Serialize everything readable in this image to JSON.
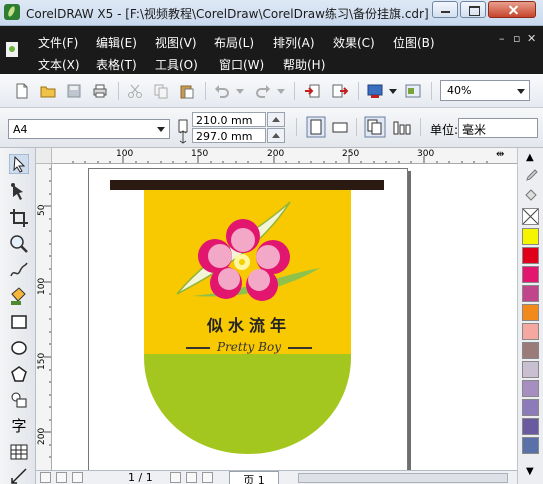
{
  "window": {
    "title": "CorelDRAW X5 - [F:\\视频教程\\CorelDraw\\CorelDraw练习\\备份挂旗.cdr]"
  },
  "menubar": {
    "row1": [
      "文件(F)",
      "编辑(E)",
      "视图(V)",
      "布局(L)",
      "排列(A)",
      "效果(C)",
      "位图(B)"
    ],
    "row2": [
      "文本(X)",
      "表格(T)",
      "工具(O)",
      "窗口(W)",
      "帮助(H)"
    ]
  },
  "toolbar": {
    "zoom": "40%"
  },
  "propbar": {
    "paper": "A4",
    "width": "210.0 mm",
    "height": "297.0 mm",
    "units_label": "单位:",
    "units_value": "毫米"
  },
  "rulers": {
    "top_ticks": [
      "100",
      "150",
      "200",
      "250",
      "300"
    ],
    "left_ticks": [
      "50",
      "100",
      "150",
      "200"
    ]
  },
  "artwork": {
    "title_cn": "似水流年",
    "subtitle_en": "Pretty  Boy",
    "colors": {
      "banner_top": "#f8c800",
      "banner_bottom": "#a3c71e",
      "rod": "#2b1a12",
      "petal_outer": "#e2166e",
      "petal_inner": "#f4a8c8"
    }
  },
  "palette": {
    "colors": [
      "#ffffff",
      "#f5f500",
      "#e0001a",
      "#e2166e",
      "#c0458a",
      "#f18a1a",
      "#f4a8a0",
      "#9b7a7a",
      "#c8c0d0",
      "#a78ec0",
      "#8b7bb8",
      "#6a5aa0",
      "#5a70a8"
    ]
  },
  "statusbar": {
    "page_count": "1 / 1",
    "page_tab": "页 1"
  }
}
